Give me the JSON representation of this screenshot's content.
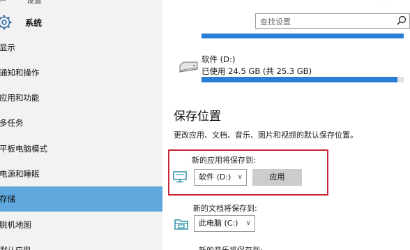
{
  "window": {
    "title": "设置"
  },
  "sidebar": {
    "header": "系统",
    "items": [
      {
        "label": "显示",
        "active": false
      },
      {
        "label": "通知和操作",
        "active": false
      },
      {
        "label": "应用和功能",
        "active": false
      },
      {
        "label": "多任务",
        "active": false
      },
      {
        "label": "平板电脑模式",
        "active": false
      },
      {
        "label": "电源和睡眠",
        "active": false
      },
      {
        "label": "存储",
        "active": true
      },
      {
        "label": "脱机地图",
        "active": false
      },
      {
        "label": "默认应用",
        "active": false
      }
    ]
  },
  "search": {
    "placeholder": "查找设置",
    "icon": "search-icon"
  },
  "storage": {
    "drive": {
      "name": "软件 (D:)",
      "usage_text": "已使用 24.5 GB (共 25.3 GB)",
      "used_gb": 24.5,
      "total_gb": 25.3,
      "icon": "drive-icon"
    }
  },
  "save_locations": {
    "title": "保存位置",
    "description": "更改应用、文档、音乐、图片和视频的默认保存位置。",
    "apps": {
      "label": "新的应用将保存到:",
      "selected": "软件 (D:)",
      "apply_label": "应用",
      "icon": "monitor-icon"
    },
    "documents": {
      "label": "新的文档将保存到:",
      "selected": "此电脑 (C:)",
      "icon": "folder-icon"
    },
    "next_label_partial": "新的音乐将保存到:"
  },
  "colors": {
    "accent": "#2a7fd4",
    "active_nav": "#5fa7dc",
    "highlight_frame": "#c8283a"
  }
}
